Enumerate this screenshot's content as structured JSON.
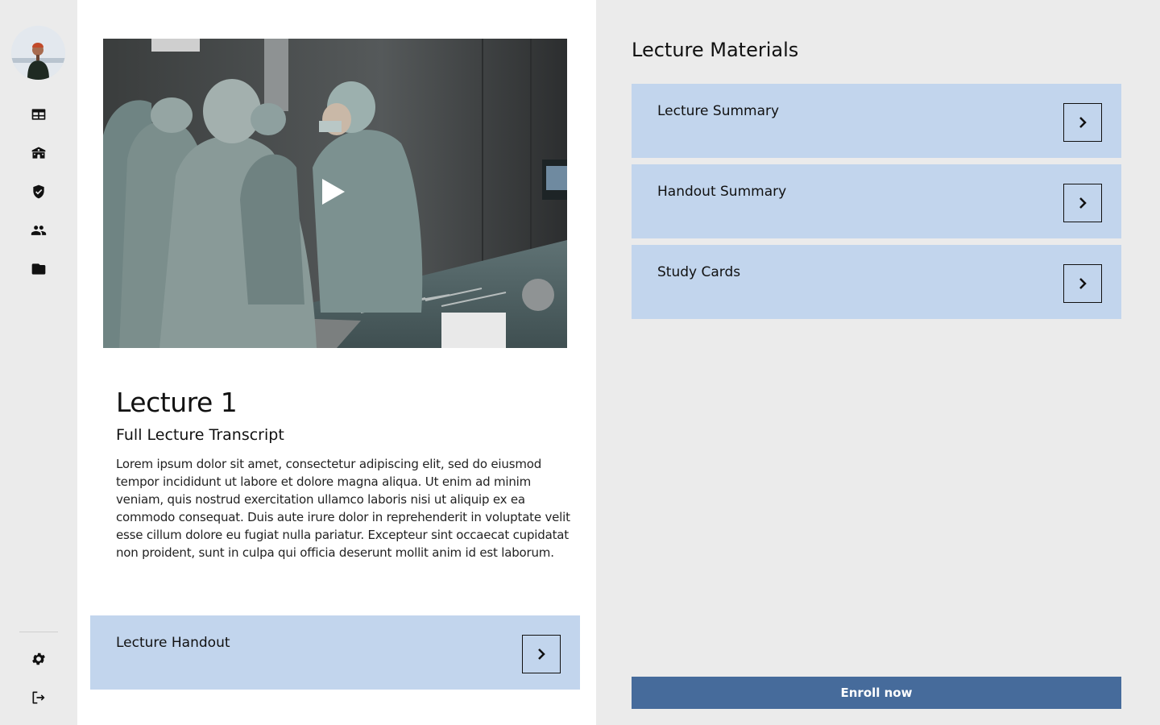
{
  "sidebar": {
    "avatar_alt": "User avatar",
    "nav_icons": [
      "dashboard-icon",
      "school-icon",
      "shield-icon",
      "people-icon",
      "folder-icon"
    ],
    "bottom_icons": [
      "settings-icon",
      "logout-icon"
    ]
  },
  "lecture": {
    "title": "Lecture 1",
    "transcript_title": "Full Lecture Transcript",
    "transcript_body": "Lorem ipsum dolor sit amet, consectetur adipiscing elit, sed do eiusmod tempor incididunt ut labore et dolore magna aliqua. Ut enim ad minim veniam, quis nostrud exercitation ullamco laboris nisi ut aliquip ex ea commodo consequat. Duis aute irure dolor in reprehenderit in voluptate velit esse cillum dolore eu fugiat nulla pariatur. Excepteur sint occaecat cupidatat non proident, sunt in culpa qui officia deserunt mollit anim id est laborum.",
    "handout_label": "Lecture Handout"
  },
  "materials": {
    "title": "Lecture Materials",
    "items": [
      {
        "label": "Lecture Summary"
      },
      {
        "label": "Handout Summary"
      },
      {
        "label": "Study Cards"
      }
    ],
    "enroll_label": "Enroll now"
  },
  "colors": {
    "card_bg": "#c2d5ed",
    "enroll_bg": "#466b9b",
    "panel_bg": "#ebebeb"
  }
}
